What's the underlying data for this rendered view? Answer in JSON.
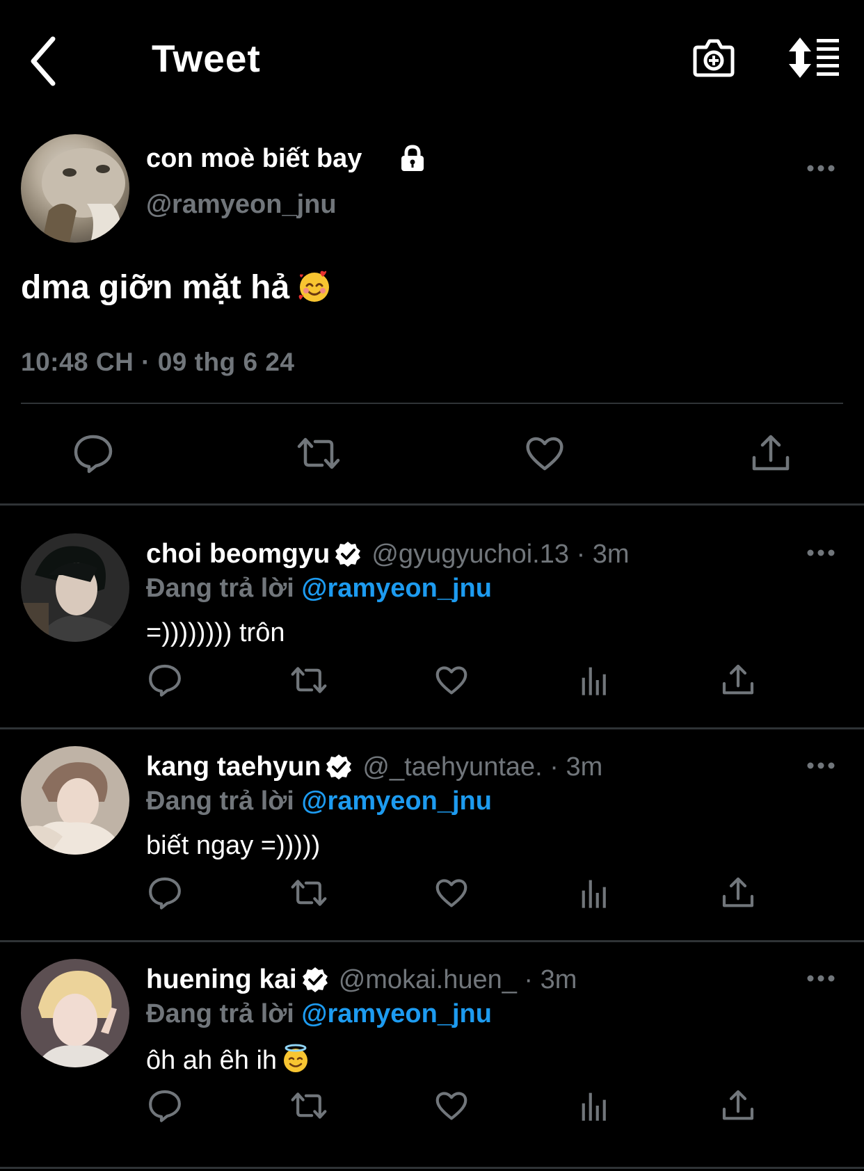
{
  "header": {
    "title": "Tweet",
    "back_icon": "chevron-left-icon",
    "camera_icon": "camera-plus-icon",
    "sort_icon": "sort-list-icon"
  },
  "main_tweet": {
    "display_name": "con moè biết bay",
    "handle": "@ramyeon_jnu",
    "text": "dma giỡn mặt hả",
    "emoji": "smiling-face-with-hearts",
    "timestamp": "10:48 CH · 09 thg 6 24",
    "protected": true
  },
  "replies": [
    {
      "display_name": "choi beomgyu",
      "verified": true,
      "handle": "@gyugyuchoi.13 · 3m",
      "replying_prefix": "Đang trả lời",
      "replying_to": "@ramyeon_jnu",
      "text": "=)))))))) trôn"
    },
    {
      "display_name": "kang taehyun",
      "verified": true,
      "handle": "@_taehyuntae. · 3m",
      "replying_prefix": "Đang trả lời",
      "replying_to": "@ramyeon_jnu",
      "text": "biết ngay =)))))"
    },
    {
      "display_name": "huening kai",
      "verified": true,
      "handle": "@mokai.huen_ · 3m",
      "replying_prefix": "Đang trả lời",
      "replying_to": "@ramyeon_jnu",
      "text": "ôh ah êh ih",
      "emoji": "smiling-face-with-halo"
    }
  ],
  "colors": {
    "background": "#000000",
    "muted": "#71767b",
    "accent": "#1d9bf0",
    "divider": "#2f3336",
    "verified": "#ffffff"
  }
}
